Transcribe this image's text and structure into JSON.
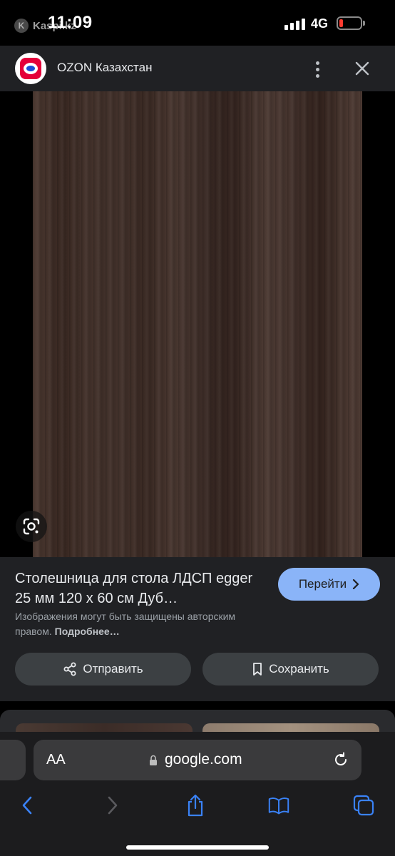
{
  "status_bar": {
    "back_app": "Kaspi.kz",
    "back_badge": "K",
    "time": "11:09",
    "network": "4G",
    "battery_color": "#ff3b30"
  },
  "source": {
    "title": "OZON Казахстан",
    "logo_icon": "ozon-logo",
    "more_icon": "more-vertical-icon",
    "close_icon": "close-icon"
  },
  "image": {
    "lens_icon": "google-lens-icon"
  },
  "result": {
    "title": "Столешница для стола ЛДСП egger 25 мм 120 х 60 см Дуб…",
    "goto_label": "Перейти",
    "copyright_text": "Изображения могут быть защищены авторским правом.",
    "copyright_link": "Подробнее…",
    "share_label": "Отправить",
    "save_label": "Сохранить",
    "accent_color": "#8ab4f8"
  },
  "browser": {
    "aa_label": "AA",
    "url": "google.com"
  }
}
